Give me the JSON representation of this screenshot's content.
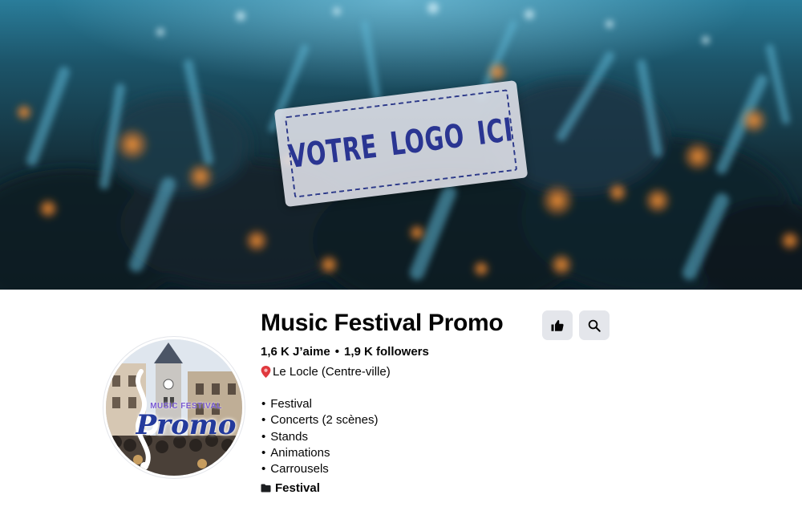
{
  "cover": {
    "logo_text": "VOTRE LOGO ICI"
  },
  "avatar": {
    "brand_top": "MUSIC FESTIVAL",
    "brand_main": "Promo"
  },
  "page": {
    "name": "Music Festival Promo",
    "likes": "1,6 K J’aime",
    "separator": "•",
    "followers": "1,9 K followers",
    "location": "Le Locle (Centre-ville)",
    "features": [
      "Festival",
      "Concerts (2 scènes)",
      "Stands",
      "Animations",
      "Carrousels"
    ],
    "category": "Festival"
  },
  "icons": {
    "like": "thumbs-up-icon",
    "search": "magnifier-icon",
    "location": "pin-icon",
    "category": "folder-icon"
  },
  "colors": {
    "button_bg": "#e4e6eb",
    "text": "#050505",
    "pin": "#e0393e",
    "sign_text": "#2a3592"
  }
}
